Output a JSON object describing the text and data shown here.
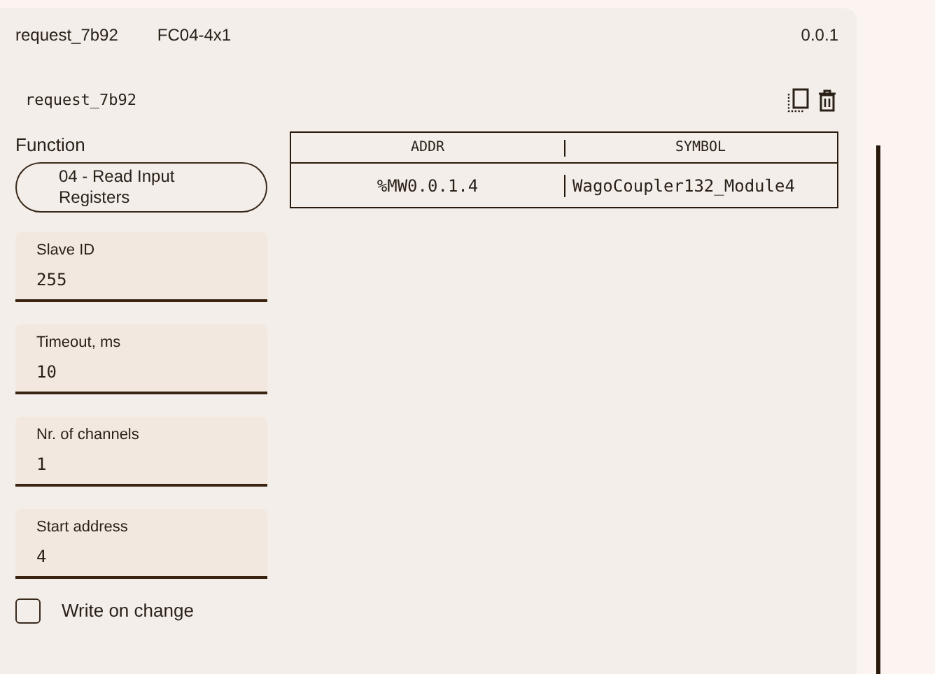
{
  "header": {
    "name": "request_7b92",
    "code": "FC04-4x1",
    "version": "0.0.1"
  },
  "request": {
    "name": "request_7b92"
  },
  "function": {
    "label": "Function",
    "value": "04 - Read Input Registers"
  },
  "fields": [
    {
      "label": "Slave ID",
      "value": "255"
    },
    {
      "label": "Timeout, ms",
      "value": "10"
    },
    {
      "label": "Nr. of channels",
      "value": "1"
    },
    {
      "label": "Start address",
      "value": "4"
    }
  ],
  "write_on_change": {
    "label": "Write on change",
    "checked": false
  },
  "table": {
    "columns": [
      "ADDR",
      "SYMBOL"
    ],
    "rows": [
      [
        "%MW0.0.1.4",
        "WagoCoupler132_Module4"
      ]
    ]
  }
}
